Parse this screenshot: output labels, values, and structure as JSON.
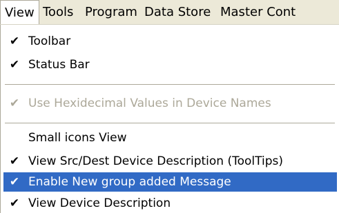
{
  "menubar": {
    "items": [
      "View",
      "Tools",
      "Program",
      "Data Store",
      "Master Cont"
    ]
  },
  "view_menu": {
    "check_glyph": "✔",
    "items": [
      {
        "label": "Toolbar",
        "checked": true
      },
      {
        "label": "Status Bar",
        "checked": true
      },
      {
        "label": "Use Hexidecimal Values in Device Names",
        "checked": true,
        "disabled": true
      },
      {
        "label": "Small icons View",
        "checked": false
      },
      {
        "label": "View Src/Dest Device Description (ToolTips)",
        "checked": true
      },
      {
        "label": "Enable New group added Message",
        "checked": true,
        "highlighted": true
      },
      {
        "label": "View Device Description",
        "checked": true
      }
    ]
  },
  "colors": {
    "menubar_bg": "#ece9d8",
    "highlight": "#316ac5",
    "disabled_text": "#aca899"
  }
}
